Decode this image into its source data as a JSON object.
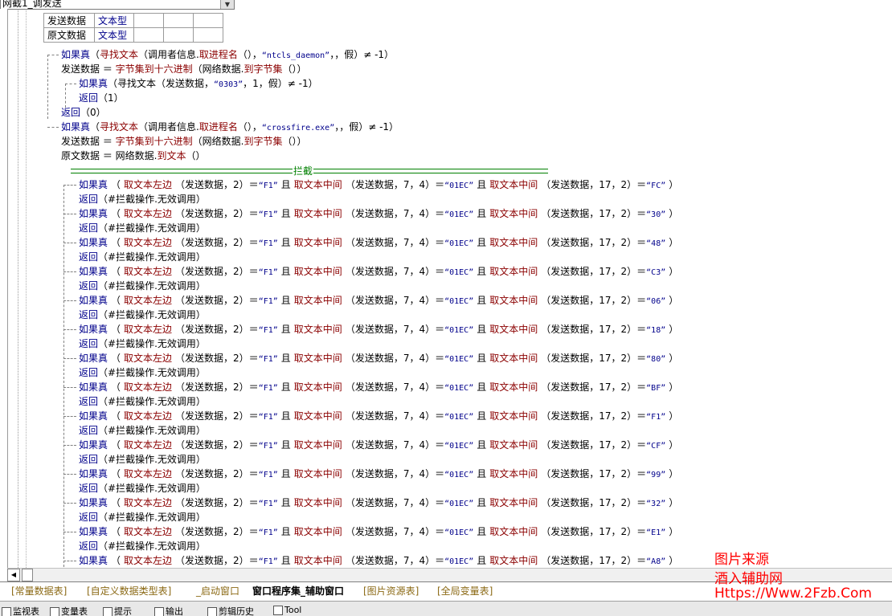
{
  "top_combo": {
    "value": "网截1_调发送"
  },
  "vars_table": [
    {
      "name": "发送数据",
      "type": "文本型"
    },
    {
      "name": "原文数据",
      "type": "文本型"
    }
  ],
  "code": {
    "l1": {
      "kw": "如果真",
      "a": "（",
      "fn1": "寻找文本",
      "b": "（调用者信息.",
      "fn2": "取进程名",
      "c": "（），",
      "s": "“ntcls_daemon”",
      "d": "，，假）≠ -1）"
    },
    "l2": {
      "a": "发送数据 ＝ ",
      "fn": "字节集到十六进制",
      "b": "（网络数据.",
      "fn2": "到字节集",
      "c": "（））"
    },
    "l3": {
      "kw": "如果真",
      "a": "（寻找文本（发送数据，",
      "s": "“0303”",
      "b": "，1，假）≠ -1）"
    },
    "l4": {
      "kw": "返回",
      "a": "（1）"
    },
    "l5": {
      "kw": "返回",
      "a": "（0）"
    },
    "l6": {
      "kw": "如果真",
      "a": "（",
      "fn1": "寻找文本",
      "b": "（调用者信息.",
      "fn2": "取进程名",
      "c": "（），",
      "s": "“crossfire.exe”",
      "d": "，，假）≠ -1）"
    },
    "l7": {
      "a": "发送数据 ＝ ",
      "fn": "字节集到十六进制",
      "b": "（网络数据.",
      "fn2": "到字节集",
      "c": "（））"
    },
    "l8": {
      "a": "原文数据 ＝ 网络数据.",
      "fn": "到文本",
      "b": "（）"
    },
    "separator_label": "拦截"
  },
  "rule_common": {
    "kw": "如果真",
    "p1": "（",
    "fn_left": "取文本左边",
    "a1": "（发送数据，2）＝",
    "s1": "“F1”",
    "and1": "且",
    "fn_mid": "取文本中间",
    "a2": "（发送数据，7，4）＝",
    "s2": "“01EC”",
    "and2": "且",
    "a3": "（发送数据，17，2）＝",
    "close": "）",
    "ret": "返回",
    "ret_arg": "（#拦截操作.无效调用）"
  },
  "rules": [
    "“FC”",
    "“30”",
    "“48”",
    "“C3”",
    "“06”",
    "“18”",
    "“80”",
    "“BF”",
    "“F1”",
    "“CF”",
    "“99”",
    "“32”",
    "“E1”",
    "“A8”"
  ],
  "tabs": [
    {
      "label": "[常量数据表]"
    },
    {
      "label": "[自定义数据类型表]"
    },
    {
      "label": "_启动窗口"
    },
    {
      "label": "窗口程序集_辅助窗口"
    },
    {
      "label": "[图片资源表]"
    },
    {
      "label": "[全局变量表]"
    }
  ],
  "bottom_bar": [
    {
      "label": "监视表"
    },
    {
      "label": "变量表"
    },
    {
      "label": "提示"
    },
    {
      "label": "输出"
    },
    {
      "label": "剪辑历史"
    },
    {
      "label": "Tool"
    }
  ],
  "watermark": {
    "line1": "图片来源",
    "line2": "酒入辅助网",
    "line3": "Https://Www.2Fzb.Com"
  }
}
